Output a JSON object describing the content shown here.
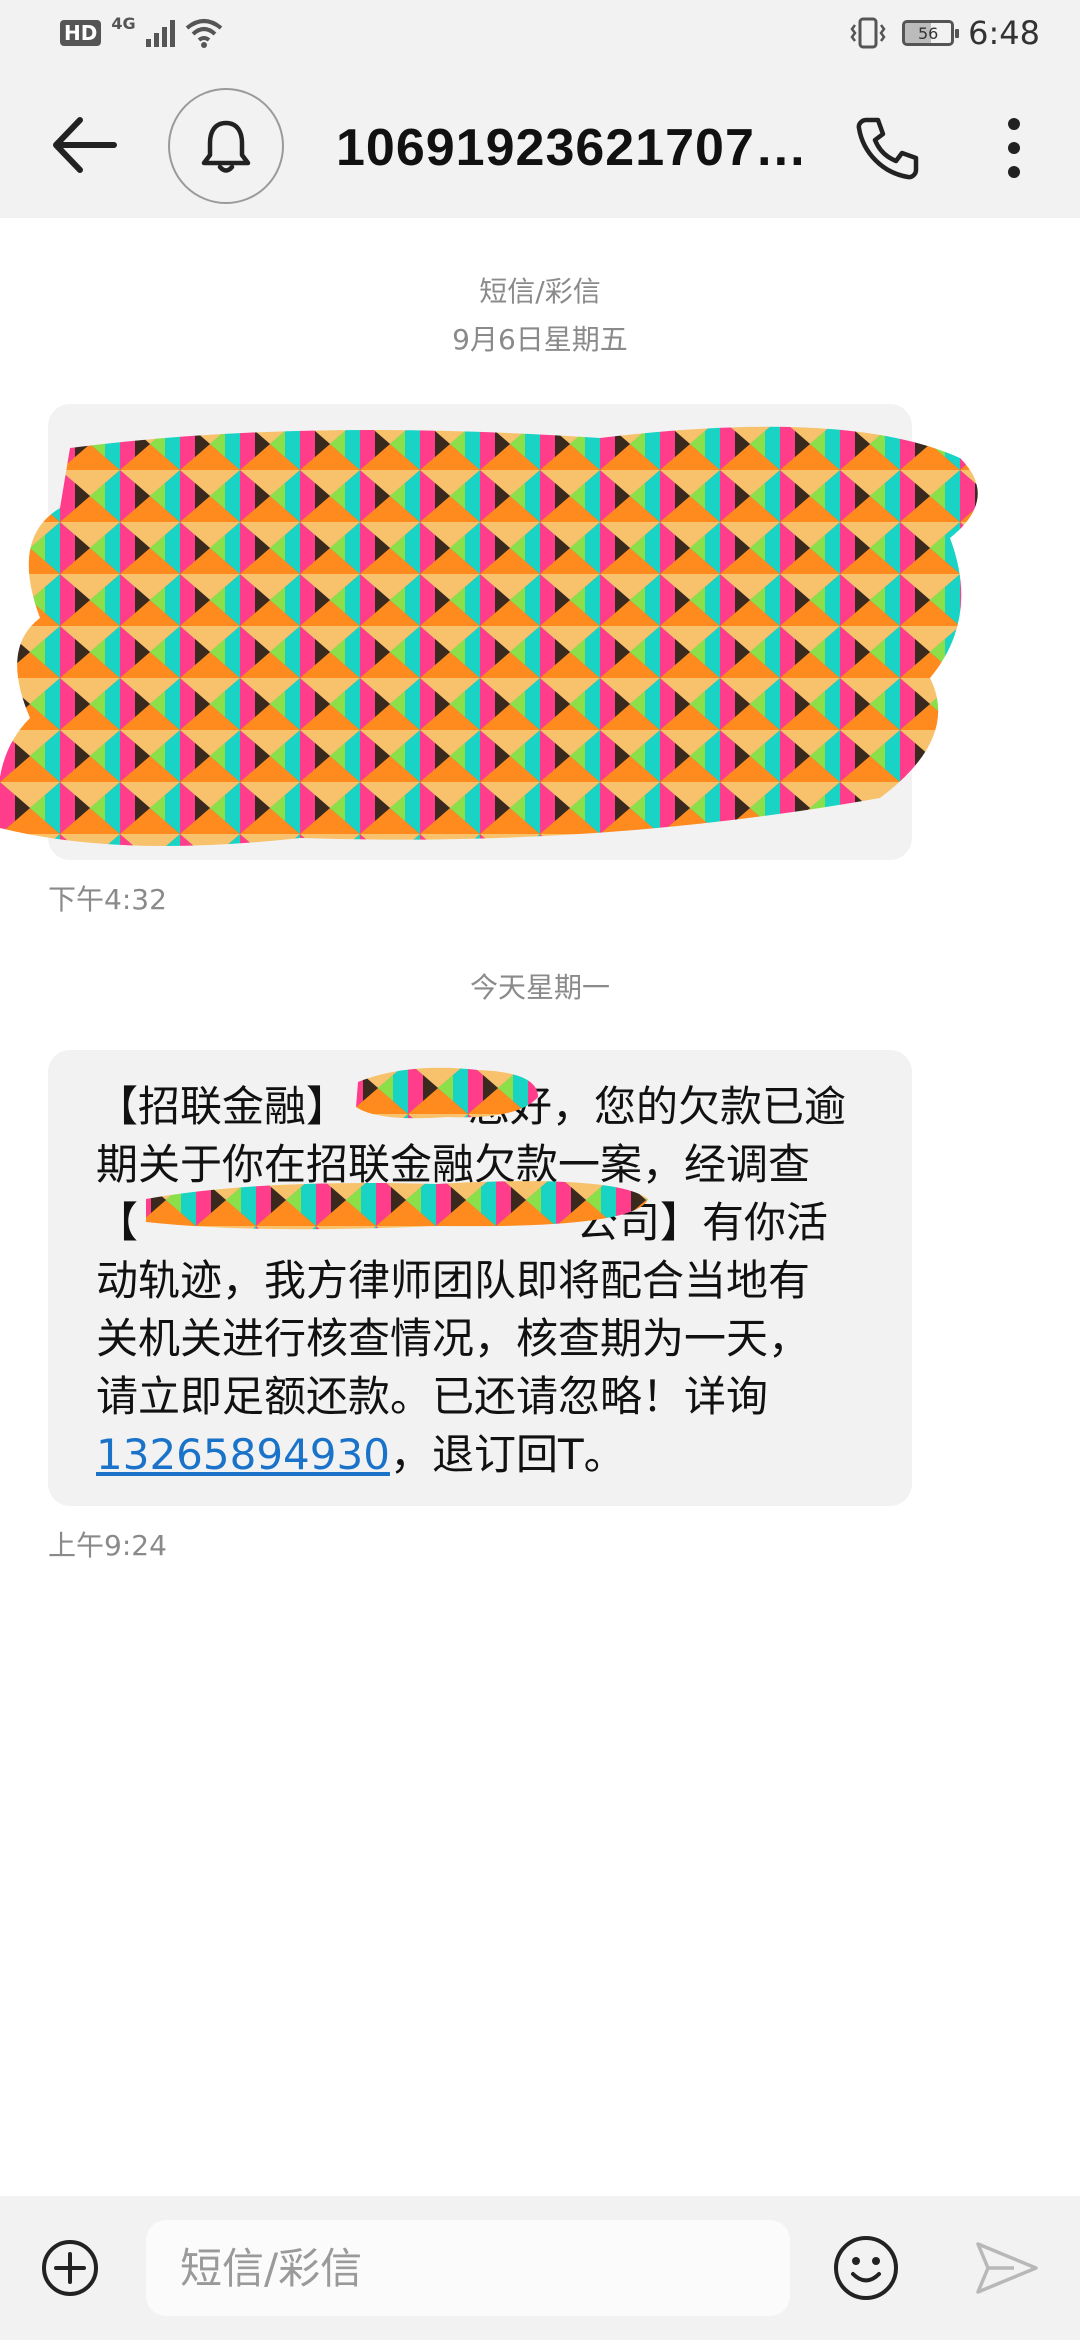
{
  "status_bar": {
    "hd": "HD",
    "network": "4G",
    "battery": "56",
    "time": "6:48"
  },
  "header": {
    "contact": "10691923621707…"
  },
  "conversation": {
    "sms_label": "短信/彩信",
    "date1": "9月6日星期五",
    "time1": "下午4:32",
    "date2": "今天星期一",
    "message2": {
      "line1_a": "【招联金融】",
      "line1_b": "您好，您的欠款已逾",
      "line2": "期关于你在招联金融欠款一案，经调查",
      "line3_a": "【",
      "line3_b": "公司】有你活",
      "line4": "动轨迹，我方律师团队即将配合当地有",
      "line5": "关机关进行核查情况，核查期为一天，",
      "line6": "请立即足额还款。已还请忽略！详询",
      "phone": "13265894930",
      "tail": "，退订回T。"
    },
    "time2": "上午9:24"
  },
  "composer": {
    "placeholder": "短信/彩信"
  },
  "colors": {
    "bar_bg": "#f2f2f2",
    "bubble_bg": "#f2f2f2",
    "link": "#1a73c9",
    "muted": "#8a8a8a"
  }
}
